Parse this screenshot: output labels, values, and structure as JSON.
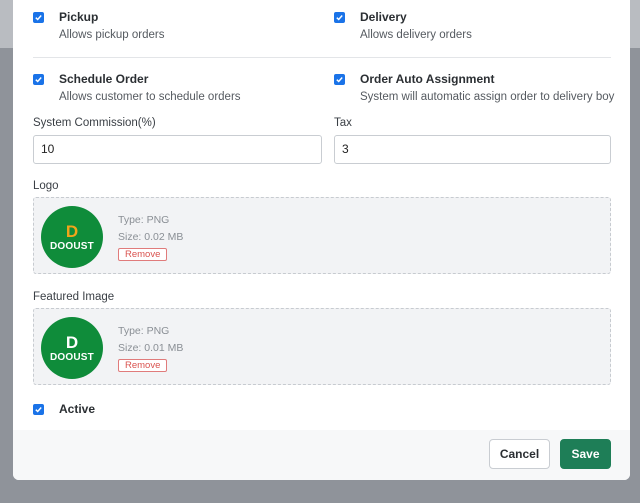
{
  "options": {
    "pickup": {
      "title": "Pickup",
      "desc": "Allows pickup orders",
      "checked": true
    },
    "delivery": {
      "title": "Delivery",
      "desc": "Allows delivery orders",
      "checked": true
    },
    "schedule_order": {
      "title": "Schedule Order",
      "desc": "Allows customer to schedule orders",
      "checked": true
    },
    "auto_assign": {
      "title": "Order Auto Assignment",
      "desc": "System will automatic assign order to delivery boy",
      "checked": true
    }
  },
  "commission": {
    "label": "System Commission(%)",
    "value": "10"
  },
  "tax": {
    "label": "Tax",
    "value": "3"
  },
  "logo": {
    "label": "Logo",
    "type": "Type: PNG",
    "size": "Size: 0.02 MB",
    "remove": "Remove",
    "brand_letter": "D",
    "brand_word": "DOOUST",
    "letter_color": "#f2a51a"
  },
  "featured": {
    "label": "Featured Image",
    "type": "Type: PNG",
    "size": "Size: 0.01 MB",
    "remove": "Remove",
    "brand_letter": "D",
    "brand_word": "DOOUST",
    "letter_color": "#ffffff"
  },
  "active": {
    "title": "Active",
    "checked": true
  },
  "footer": {
    "cancel": "Cancel",
    "save": "Save"
  },
  "colors": {
    "checkbox": "#1a73e8",
    "save": "#1e7e57",
    "remove": "#d9534f",
    "brand_bg": "#0f8c3a"
  }
}
